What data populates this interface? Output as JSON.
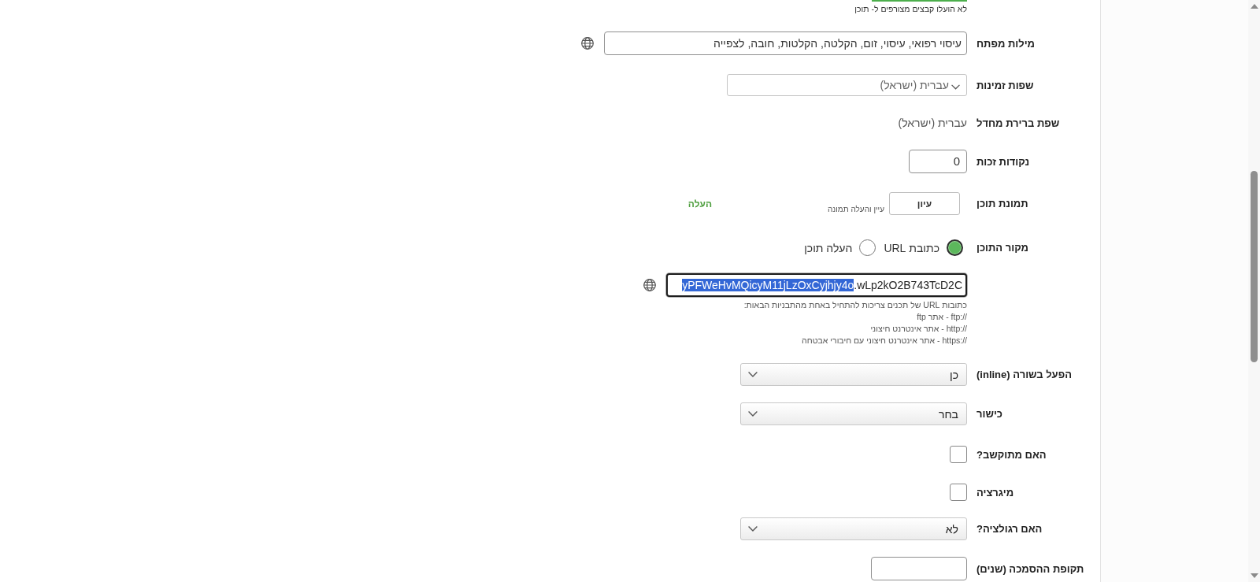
{
  "attachments": {
    "note": "לא הועלו קבצים מצורפים ל- תוכן"
  },
  "fields": [
    {
      "kind": "text",
      "label": "מילות מפתח",
      "value": "עיסוי רפואי, עיסוי, זום, הקלטה, הקלטות, חובה, לצפייה",
      "translatable": true
    },
    {
      "kind": "multiselect",
      "label": "שפות זמינות",
      "value": "עברית (ישראל)"
    },
    {
      "kind": "readonly",
      "label": "שפת ברירת מחדל",
      "value": "עברית (ישראל)"
    },
    {
      "kind": "number",
      "label": "נקודות זכות",
      "value": "0"
    },
    {
      "kind": "image",
      "label": "תמונת תוכן",
      "button": "עיון",
      "hint": "עיין והעלה תמונה",
      "action": "העלה"
    },
    {
      "kind": "radio",
      "label": "מקור התוכן",
      "options": [
        {
          "label": "כתובת URL",
          "selected": true
        },
        {
          "label": "העלה תוכן",
          "selected": false
        }
      ]
    },
    {
      "kind": "url",
      "focused": true,
      "translatable": true,
      "highlighted_text": "yPFWeHvMQicyM11jLzOxCyjhjy4o",
      "plain_text": ".wLp2kO2B743TcD2C",
      "help": {
        "intro": "כתובות URL של תכנים צריכות להתחיל באחת מהתבניות הבאות:",
        "lines": [
          {
            "prefix": "ftp://",
            "text": "- אתר ftp"
          },
          {
            "prefix": "http://",
            "text": "- אתר אינטרנט חיצוני"
          },
          {
            "prefix": "https://",
            "text": "- אתר אינטרנט חיצוני עם חיבורי אבטחה"
          }
        ]
      }
    },
    {
      "kind": "select",
      "label": "הפעל בשורה (inline)",
      "value": "כן"
    },
    {
      "kind": "select",
      "label": "כישור",
      "value": "בחר"
    },
    {
      "kind": "checkbox",
      "label": "האם מתוקשב?",
      "checked": false
    },
    {
      "kind": "checkbox",
      "label": "מיגרציה",
      "checked": false
    },
    {
      "kind": "select",
      "label": "האם רגולציה?",
      "value": "לא"
    },
    {
      "kind": "duration",
      "label": "תקופת ההסמכה (שנים)"
    }
  ]
}
